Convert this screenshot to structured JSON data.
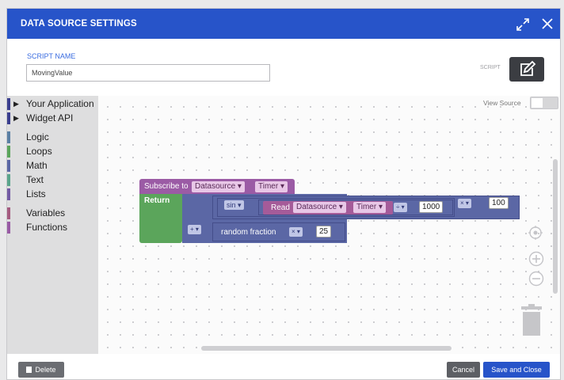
{
  "dialog": {
    "title": "DATA SOURCE SETTINGS",
    "script_name_label": "SCRIPT NAME",
    "script_name_value": "MovingValue",
    "script_label": "SCRIPT"
  },
  "toolbox": {
    "groups": [
      {
        "label": "Your Application",
        "color": "#3b3f8f",
        "expandable": true
      },
      {
        "label": "Widget API",
        "color": "#3b3f8f",
        "expandable": true
      },
      {
        "label": "Logic",
        "color": "#5b80a5"
      },
      {
        "label": "Loops",
        "color": "#5ba55b"
      },
      {
        "label": "Math",
        "color": "#5b67a5"
      },
      {
        "label": "Text",
        "color": "#5ba58c"
      },
      {
        "label": "Lists",
        "color": "#745ba5"
      },
      {
        "label": "Variables",
        "color": "#a55b80"
      },
      {
        "label": "Functions",
        "color": "#995ba5"
      }
    ]
  },
  "canvas": {
    "view_source_label": "View Source",
    "blocks": {
      "subscribe_to": "Subscribe to",
      "datasource_field": "Datasource",
      "timer_field": "Timer",
      "return_label": "Return",
      "sin_label": "sin",
      "read_label": "Read",
      "read_datasource_field": "Datasource",
      "read_timer_field": "Timer",
      "divide_op": "÷",
      "times_op": "×",
      "plus_op": "+",
      "value_1000": "1000",
      "value_100": "100",
      "random_fraction": "random fraction",
      "value_25": "25"
    }
  },
  "footer": {
    "delete_label": "Delete",
    "cancel_label": "Cancel",
    "save_label": "Save and Close"
  },
  "colors": {
    "title_bar": "#2754c9",
    "event_block": "#9b5ba5",
    "return_block": "#5ba55b",
    "math_block": "#5b67a5",
    "read_block": "#a55b99",
    "save_button": "#2754c9"
  }
}
